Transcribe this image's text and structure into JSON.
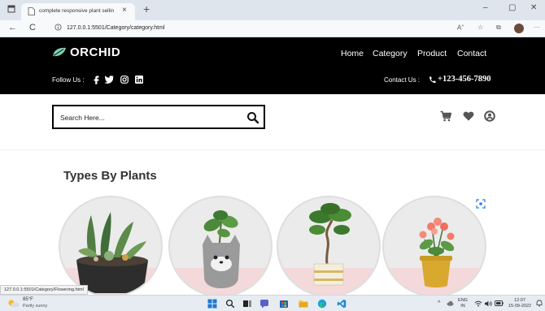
{
  "browser": {
    "tab_title": "complete responsive plant sellin",
    "tab_close": "×",
    "new_tab": "+",
    "window_controls": {
      "minimize": "–",
      "maximize": "▢",
      "close": "✕"
    },
    "nav": {
      "back": "←",
      "refresh": "C"
    },
    "url": "127.0.0.1:5501/Category/category.html",
    "status_url": "127.0.0.1:5501/Category/Flowering.html"
  },
  "header": {
    "brand": "ORCHID",
    "nav": [
      "Home",
      "Category",
      "Product",
      "Contact"
    ],
    "follow_label": "Follow Us :",
    "social_icons": [
      "facebook-icon",
      "twitter-icon",
      "instagram-icon",
      "linkedin-icon"
    ],
    "contact_label": "Contact Us :",
    "phone": "+123-456-7890"
  },
  "search": {
    "placeholder": "Search Here..."
  },
  "section": {
    "title": "Types By Plants",
    "items": [
      "succulent-planter",
      "cat-planter",
      "bonsai-planter",
      "flowering-planter"
    ]
  },
  "taskbar": {
    "weather_temp": "85°F",
    "weather_desc": "Partly sunny",
    "lang": "ENG",
    "region": "IN",
    "time": "12:07",
    "date": "15-09-2022"
  },
  "colors": {
    "header_bg": "#000000",
    "leaf": "#7fd1b9",
    "heading": "#333333"
  }
}
